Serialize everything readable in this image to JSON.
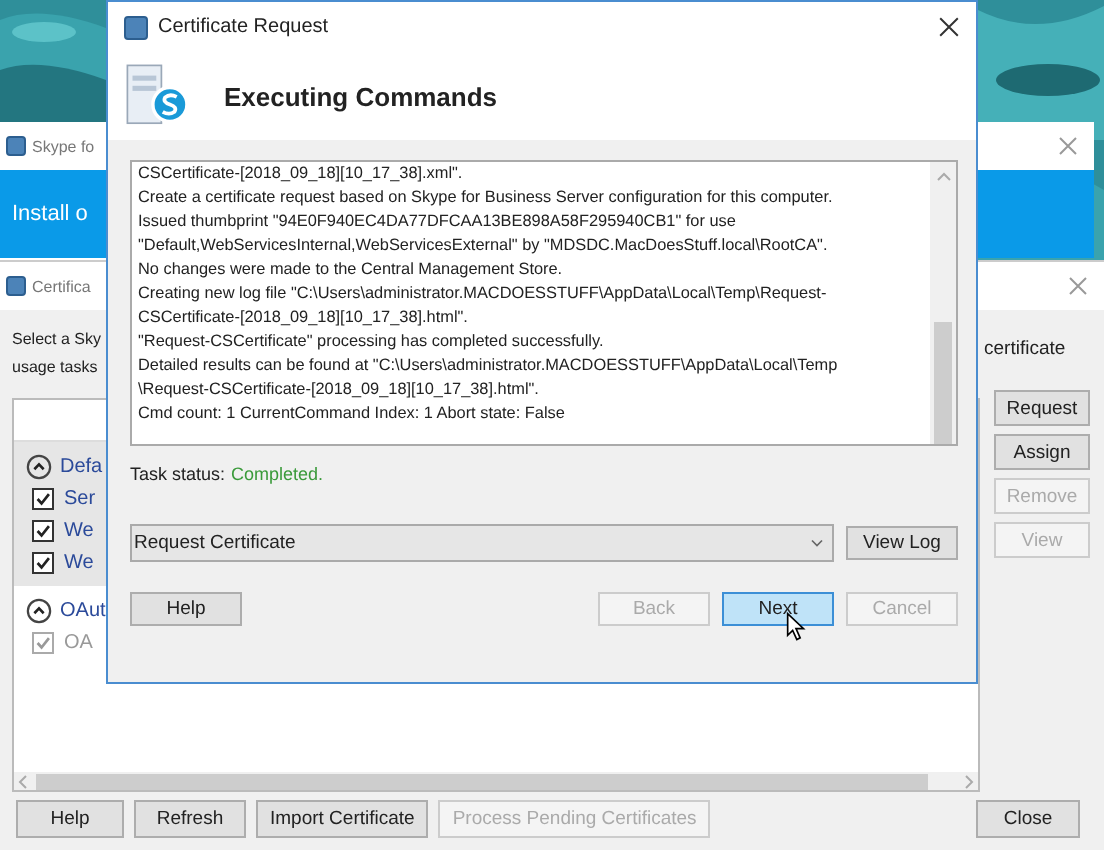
{
  "skype_window": {
    "title": "Skype fo",
    "banner": "Install o"
  },
  "cert_window": {
    "title": "Certifica",
    "intro": [
      "Select a Sky",
      "usage tasks"
    ],
    "intro_right": "certificate",
    "groups": [
      {
        "label": "Defa",
        "expanded": true,
        "selected": true,
        "items": [
          {
            "label": "Ser",
            "checked": true,
            "disabled": false
          },
          {
            "label": "We",
            "checked": true,
            "disabled": false
          },
          {
            "label": "We",
            "checked": true,
            "disabled": false
          }
        ]
      },
      {
        "label": "OAut",
        "expanded": true,
        "selected": false,
        "items": [
          {
            "label": "OA",
            "checked": true,
            "disabled": true
          }
        ]
      }
    ],
    "side_buttons": [
      {
        "label": "Request",
        "disabled": false
      },
      {
        "label": "Assign",
        "disabled": false
      },
      {
        "label": "Remove",
        "disabled": true
      },
      {
        "label": "View",
        "disabled": true
      }
    ],
    "bottom_buttons": [
      {
        "label": "Help",
        "disabled": false
      },
      {
        "label": "Refresh",
        "disabled": false
      },
      {
        "label": "Import Certificate",
        "disabled": false
      },
      {
        "label": "Process Pending Certificates",
        "disabled": true
      }
    ],
    "close_button": "Close"
  },
  "dialog": {
    "title": "Certificate Request",
    "heading": "Executing Commands",
    "log": [
      "CSCertificate-[2018_09_18][10_17_38].xml\".",
      "Create a certificate request based on Skype for Business Server configuration for this computer.",
      "Issued thumbprint \"94E0F940EC4DA77DFCAA13BE898A58F295940CB1\" for use",
      "\"Default,WebServicesInternal,WebServicesExternal\" by \"MDSDC.MacDoesStuff.local\\RootCA\".",
      "No changes were made to the Central Management Store.",
      "Creating new log file \"C:\\Users\\administrator.MACDOESSTUFF\\AppData\\Local\\Temp\\Request-",
      "CSCertificate-[2018_09_18][10_17_38].html\".",
      "\"Request-CSCertificate\" processing has completed successfully.",
      "Detailed results can be found at \"C:\\Users\\administrator.MACDOESSTUFF\\AppData\\Local\\Temp",
      "\\Request-CSCertificate-[2018_09_18][10_17_38].html\".",
      "Cmd count: 1 CurrentCommand Index: 1 Abort state: False"
    ],
    "task_status_label": "Task status:",
    "task_status": "Completed.",
    "command": "Request Certificate",
    "view_log": "View Log",
    "help": "Help",
    "nav_buttons": [
      {
        "label": "Back",
        "disabled": true,
        "selected": false
      },
      {
        "label": "Next",
        "disabled": false,
        "selected": true
      },
      {
        "label": "Cancel",
        "disabled": true,
        "selected": false
      }
    ]
  }
}
